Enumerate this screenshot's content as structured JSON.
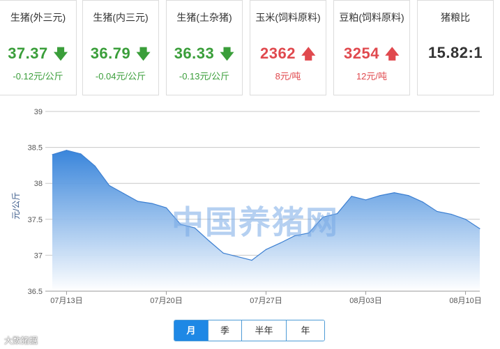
{
  "cards": [
    {
      "title": "生猪(外三元)",
      "value": "37.37",
      "trend": "down",
      "arrow": "🡇",
      "change": "-0.12元/公斤"
    },
    {
      "title": "生猪(内三元)",
      "value": "36.79",
      "trend": "down",
      "arrow": "🡇",
      "change": "-0.04元/公斤"
    },
    {
      "title": "生猪(土杂猪)",
      "value": "36.33",
      "trend": "down",
      "arrow": "🡇",
      "change": "-0.13元/公斤"
    },
    {
      "title": "玉米(饲料原料)",
      "value": "2362",
      "trend": "up",
      "arrow": "🡅",
      "change": "8元/吨"
    },
    {
      "title": "豆粕(饲料原料)",
      "value": "3254",
      "trend": "up",
      "arrow": "🡅",
      "change": "12元/吨"
    },
    {
      "title": "猪粮比",
      "value": "15.82:1",
      "trend": "neutral",
      "arrow": "",
      "change": ""
    }
  ],
  "watermark": "中国养猪网",
  "tabs": [
    {
      "label": "月",
      "active": true
    },
    {
      "label": "季",
      "active": false
    },
    {
      "label": "半年",
      "active": false
    },
    {
      "label": "年",
      "active": false
    }
  ],
  "brand": "大数猪据",
  "colors": {
    "down": "#3a9e3a",
    "up": "#e0494e",
    "line": "#3c7fd1",
    "fill_top": "#2f7fd9",
    "fill_bottom": "#ffffff",
    "tab_active": "#1e88e5"
  },
  "chart_data": {
    "type": "area",
    "ylabel": "元/公斤",
    "ylim": [
      36.5,
      39
    ],
    "yticks": [
      36.5,
      37,
      37.5,
      38,
      38.5,
      39
    ],
    "xticks": [
      "07月13日",
      "07月20日",
      "07月27日",
      "08月03日",
      "08月10日"
    ],
    "grid": true,
    "x": [
      "07月12日",
      "07月13日",
      "07月14日",
      "07月15日",
      "07月16日",
      "07月17日",
      "07月18日",
      "07月19日",
      "07月20日",
      "07月21日",
      "07月22日",
      "07月23日",
      "07月24日",
      "07月25日",
      "07月26日",
      "07月27日",
      "07月28日",
      "07月29日",
      "07月30日",
      "07月31日",
      "08月01日",
      "08月02日",
      "08月03日",
      "08月04日",
      "08月05日",
      "08月06日",
      "08月07日",
      "08月08日",
      "08月09日",
      "08月10日",
      "08月11日"
    ],
    "values": [
      38.4,
      38.46,
      38.41,
      38.24,
      37.97,
      37.86,
      37.75,
      37.72,
      37.66,
      37.43,
      37.38,
      37.2,
      37.03,
      36.98,
      36.93,
      37.08,
      37.17,
      37.27,
      37.31,
      37.53,
      37.58,
      37.82,
      37.77,
      37.83,
      37.87,
      37.83,
      37.74,
      37.61,
      37.57,
      37.5,
      37.37
    ]
  }
}
